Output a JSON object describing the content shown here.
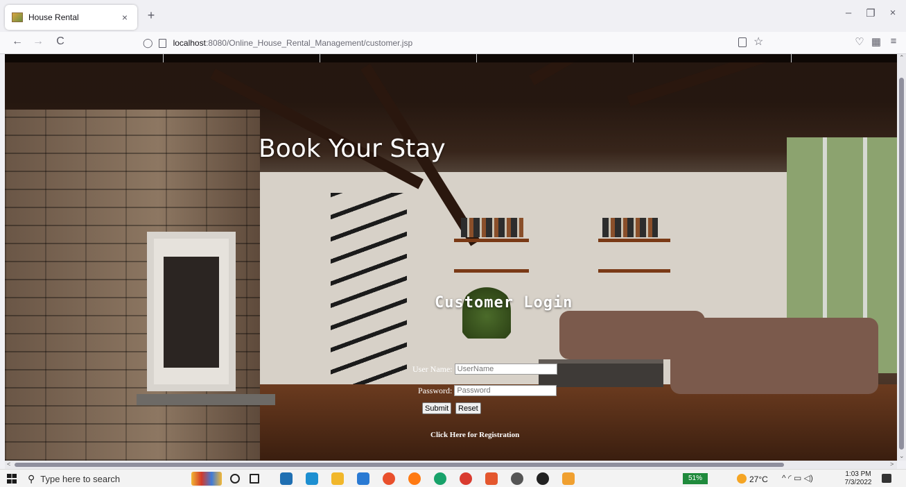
{
  "browser": {
    "tab_title": "House Rental",
    "url_host": "localhost",
    "url_path": ":8080/Online_House_Rental_Management/customer.jsp"
  },
  "icons": {
    "back": "←",
    "forward": "→",
    "reload": "C",
    "new_tab": "+",
    "close_tab": "×",
    "minimize": "–",
    "restore": "❐",
    "close": "×",
    "shield": "◯",
    "star": "☆",
    "pocket": "♡",
    "extensions": "▦",
    "menu": "≡",
    "search": "⚲",
    "up_arrow": "⌃",
    "down_arrow": "⌄",
    "left_arrow": "<",
    "right_arrow": ">"
  },
  "page": {
    "hero_title": "Book Your Stay",
    "login_title": "Customer Login",
    "username_label": "User Name:",
    "username_placeholder": "UserName",
    "password_label": "Password:",
    "password_placeholder": "Password",
    "submit_label": "Submit",
    "reset_label": "Reset",
    "registration_link": "Click Here for Registration"
  },
  "taskbar": {
    "search_placeholder": "Type here to search",
    "battery": "51%",
    "weather": "27°C",
    "tray": "^ ◜ ▭ ◁)",
    "time": "1:03 PM",
    "date": "7/3/2022"
  }
}
